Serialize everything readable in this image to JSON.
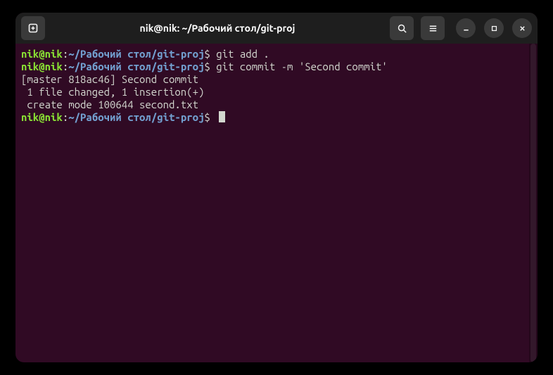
{
  "window": {
    "title": "nik@nik: ~/Рабочий стол/git-proj"
  },
  "prompt": {
    "user_host": "nik@nik",
    "colon": ":",
    "path": "~/Рабочий стол/git-proj",
    "symbol": "$"
  },
  "lines": [
    {
      "type": "cmd",
      "command": "git add ."
    },
    {
      "type": "cmd",
      "command": "git commit -m 'Second commit'"
    },
    {
      "type": "out",
      "text": "[master 818ac46] Second commit"
    },
    {
      "type": "out",
      "text": " 1 file changed, 1 insertion(+)"
    },
    {
      "type": "out",
      "text": " create mode 100644 second.txt"
    },
    {
      "type": "cmd",
      "command": "",
      "cursor": true
    }
  ]
}
